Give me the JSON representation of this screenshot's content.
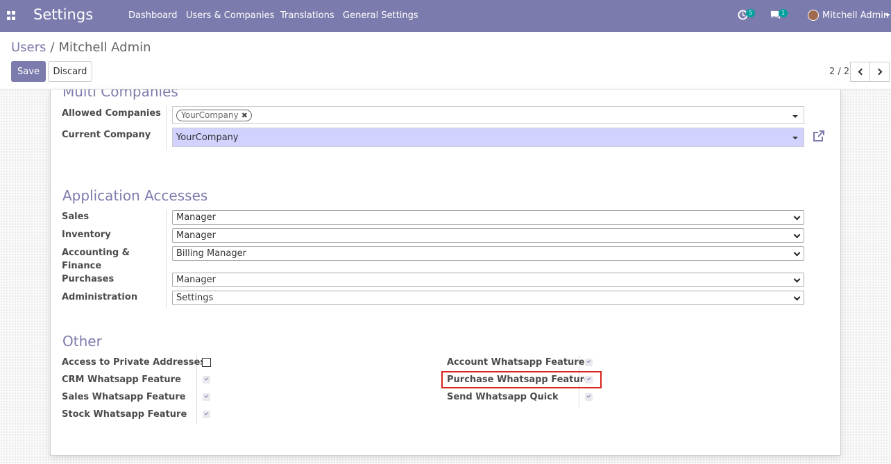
{
  "navbar": {
    "app_title": "Settings",
    "menu": [
      "Dashboard",
      "Users & Companies",
      "Translations",
      "General Settings"
    ],
    "activity_count": "5",
    "messages_count": "1",
    "user_name": "Mitchell Admin",
    "accent_color": "#7c7bad",
    "badge_color": "#00a09d"
  },
  "control_panel": {
    "breadcrumb_parent": "Users",
    "breadcrumb_separator": "/",
    "breadcrumb_current": "Mitchell Admin",
    "save_label": "Save",
    "discard_label": "Discard",
    "pager": "2 / 2"
  },
  "multi_companies": {
    "title": "Multi Companies",
    "allowed_label": "Allowed Companies",
    "allowed_tag": "YourCompany",
    "current_label": "Current Company",
    "current_value": "YourCompany"
  },
  "application_accesses": {
    "title": "Application Accesses",
    "rows": [
      {
        "label": "Sales",
        "value": "Manager"
      },
      {
        "label": "Inventory",
        "value": "Manager"
      },
      {
        "label": "Accounting & Finance",
        "value": "Billing Manager"
      },
      {
        "label": "Purchases",
        "value": "Manager"
      },
      {
        "label": "Administration",
        "value": "Settings"
      }
    ]
  },
  "other": {
    "title": "Other",
    "left": [
      {
        "label": "Access to Private Addresses",
        "checked": false
      },
      {
        "label": "CRM Whatsapp Feature",
        "checked": true
      },
      {
        "label": "Sales Whatsapp Feature",
        "checked": true
      },
      {
        "label": "Stock Whatsapp Feature",
        "checked": true
      }
    ],
    "right": [
      {
        "label": "Account Whatsapp Feature",
        "checked": true
      },
      {
        "label": "Purchase Whatsapp Feature",
        "checked": true
      },
      {
        "label": "Send Whatsapp Quick",
        "checked": true
      }
    ]
  }
}
